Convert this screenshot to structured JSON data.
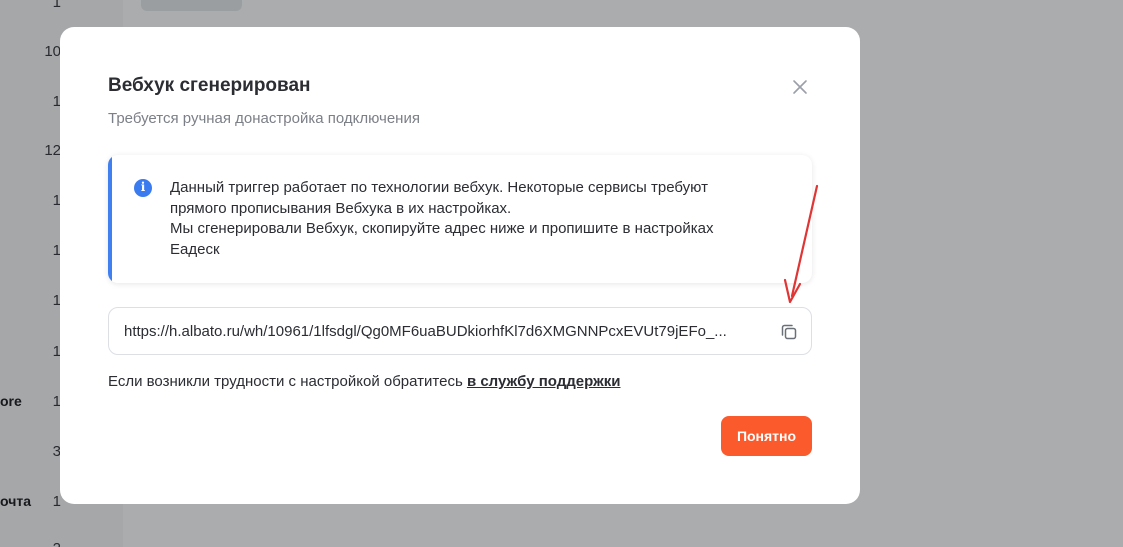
{
  "background": {
    "numbers": [
      "1",
      "10",
      "1",
      "12",
      "1",
      "1",
      "1",
      "1",
      "1",
      "3",
      "1",
      "2"
    ],
    "words": [
      "ore",
      "очта"
    ]
  },
  "modal": {
    "title": "Вебхук сгенерирован",
    "subtitle": "Требуется ручная донастройка подключения",
    "info": {
      "icon": "info-icon",
      "text_line1": "Данный триггер работает по технологии вебхук. Некоторые сервисы требуют",
      "text_line2": "прямого прописывания Вебхука в их настройках.",
      "text_line3": "Мы сгенерировали Вебхук, скопируйте адрес ниже и пропишите в настройках",
      "text_line4": "Еадеск"
    },
    "webhook_url": "https://h.albato.ru/wh/10961/1lfsdgl/Qg0MF6uaBUDkiorhfKl7d6XMGNNPcxEVUt79jEFo_...",
    "help_text": "Если возникли трудности с настройкой обратитесь ",
    "help_link": "в службу поддержки",
    "ok_button": "Понятно"
  },
  "colors": {
    "accent": "#fb5a2c",
    "info_blue": "#3f7ff0",
    "annotation_arrow": "#e03535"
  }
}
